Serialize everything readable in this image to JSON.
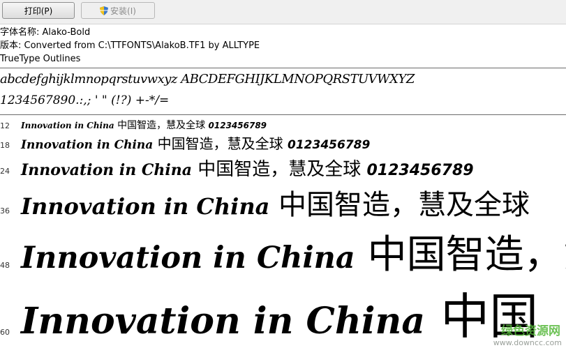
{
  "toolbar": {
    "print_label": "打印(P)",
    "install_label": "安装(I)"
  },
  "info": {
    "font_name": "字体名称: Alako-Bold",
    "version": "版本: Converted from C:\\TTFONTS\\AlakoB.TF1 by ALLTYPE",
    "type": "TrueType Outlines"
  },
  "charset": {
    "line1": "abcdefghijklmnopqrstuvwxyz ABCDEFGHIJKLMNOPQRSTUVWXYZ",
    "line2": "1234567890.:,; ' \" (!?) +-*/="
  },
  "samples": [
    {
      "size": "12",
      "latin": "Innovation in China",
      "cjk": " 中国智造，慧及全球 ",
      "digits": "0123456789"
    },
    {
      "size": "18",
      "latin": "Innovation in China",
      "cjk": " 中国智造，慧及全球 ",
      "digits": "0123456789"
    },
    {
      "size": "24",
      "latin": "Innovation in China",
      "cjk": " 中国智造，慧及全球 ",
      "digits": "0123456789"
    },
    {
      "size": "36",
      "latin": "Innovation in China",
      "cjk": " 中国智造，慧及全球",
      "digits": ""
    },
    {
      "size": "48",
      "latin": "Innovation in China",
      "cjk": " 中国智造，慧",
      "digits": ""
    },
    {
      "size": "60",
      "latin": "Innovation in China",
      "cjk": " 中国",
      "digits": ""
    }
  ],
  "watermark": {
    "text": "绿色资源网",
    "url": "www.downcc.com"
  },
  "colors": {
    "watermark": "#55b83a"
  }
}
